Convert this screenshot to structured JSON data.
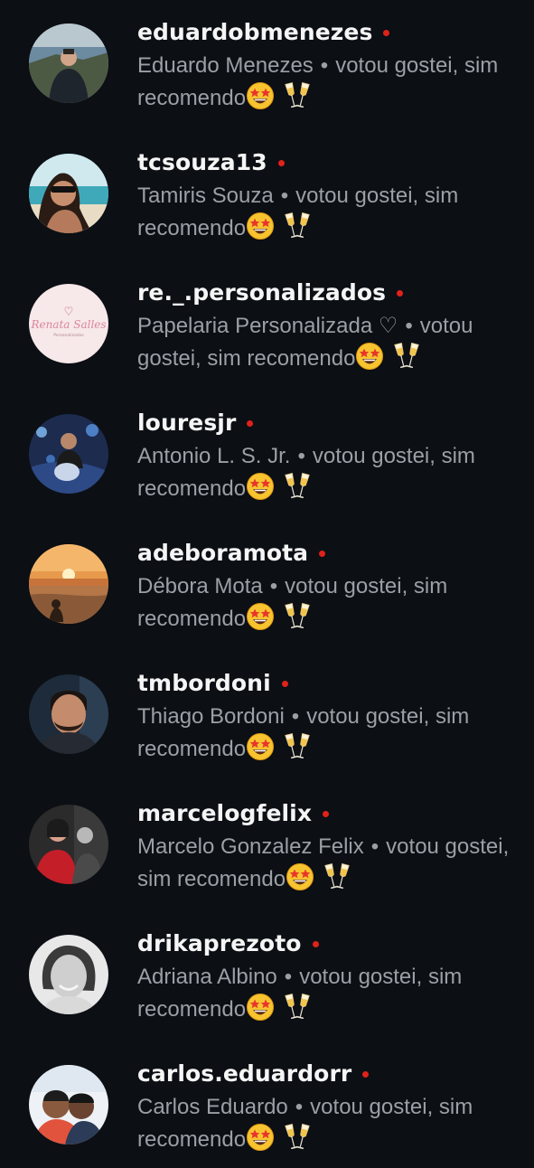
{
  "theme": {
    "background": "#0c0f14",
    "username_color": "#f5f5f5",
    "secondary_text_color": "#9aa0a6",
    "status_dot_color": "#e0221b"
  },
  "separator": "•",
  "icons": {
    "emoji_1": "star-struck-emoji-icon",
    "emoji_2": "clinking-glasses-emoji-icon"
  },
  "voters": [
    {
      "username": "eduardobmenezes",
      "display_name": "Eduardo Menezes",
      "vote_text": "votou gostei, sim recomendo"
    },
    {
      "username": "tcsouza13",
      "display_name": "Tamiris Souza",
      "vote_text": "votou gostei, sim recomendo"
    },
    {
      "username": "re._.personalizados",
      "display_name": "Papelaria Personalizada ♡",
      "vote_text": "votou gostei, sim recomendo",
      "avatar_logo": {
        "brand": "Renata Salles",
        "sub": "Personalizados"
      }
    },
    {
      "username": "louresjr",
      "display_name": "Antonio L. S. Jr.",
      "vote_text": "votou gostei, sim recomendo"
    },
    {
      "username": "adeboramota",
      "display_name": "Débora Mota",
      "vote_text": "votou gostei, sim recomendo"
    },
    {
      "username": "tmbordoni",
      "display_name": "Thiago Bordoni",
      "vote_text": "votou gostei, sim recomendo"
    },
    {
      "username": "marcelogfelix",
      "display_name": "Marcelo Gonzalez Felix",
      "vote_text": "votou gostei, sim recomendo"
    },
    {
      "username": "drikaprezoto",
      "display_name": "Adriana Albino",
      "vote_text": "votou gostei, sim recomendo"
    },
    {
      "username": "carlos.eduardorr",
      "display_name": "Carlos Eduardo",
      "vote_text": "votou gostei, sim recomendo"
    }
  ]
}
